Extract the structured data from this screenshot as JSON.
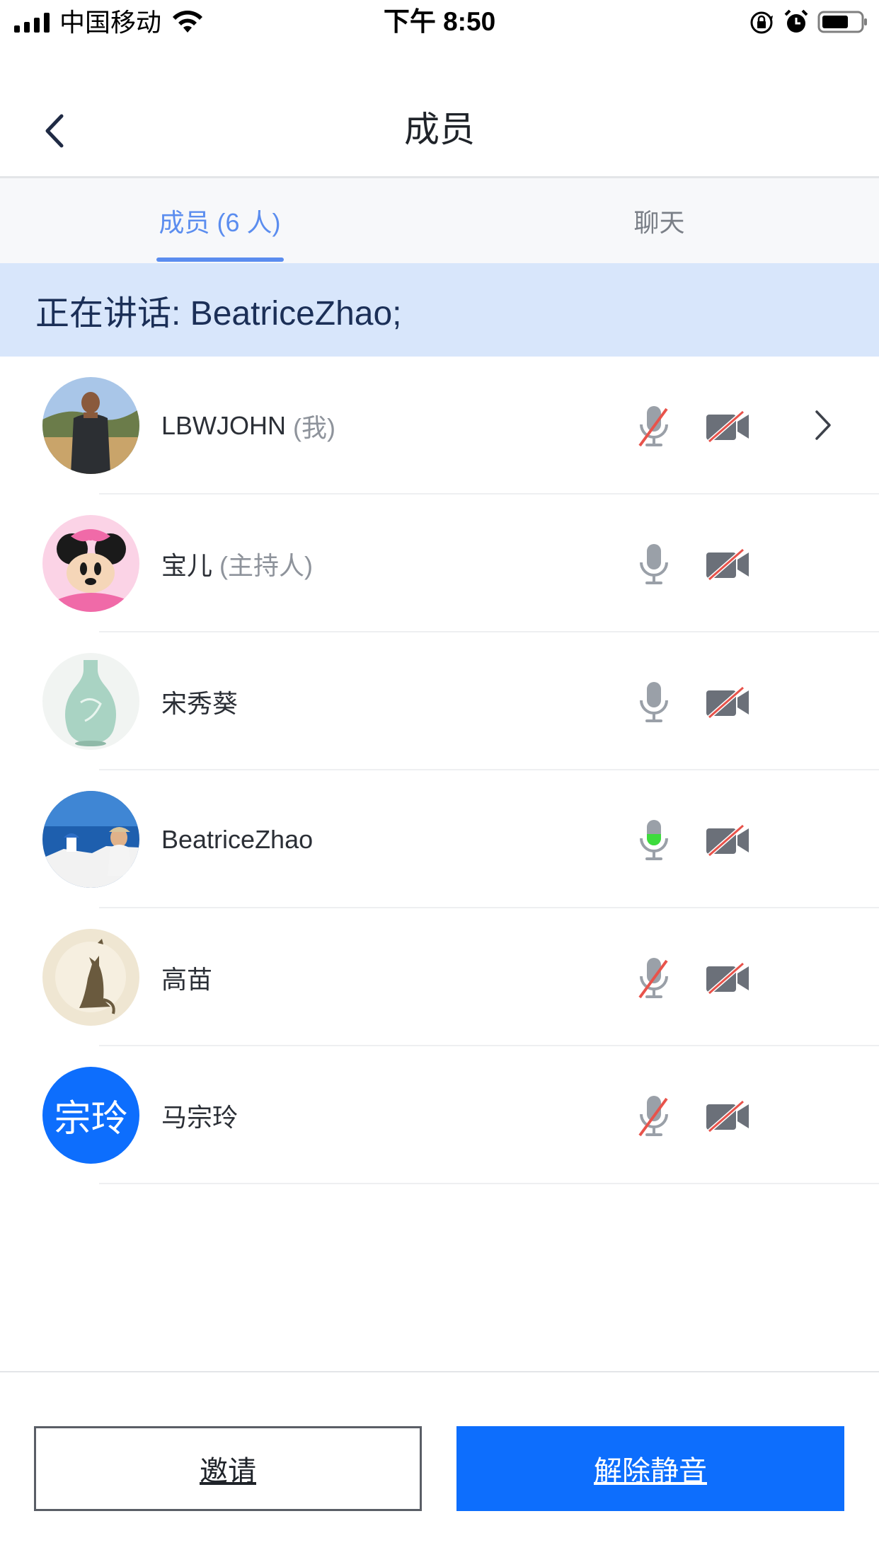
{
  "status_bar": {
    "carrier": "中国移动",
    "time": "下午 8:50"
  },
  "header": {
    "title": "成员"
  },
  "tabs": [
    {
      "label": "成员 (6 人)",
      "active": true
    },
    {
      "label": "聊天",
      "active": false
    }
  ],
  "speaking_banner": "正在讲话: BeatriceZhao;",
  "members": [
    {
      "name": "LBWJOHN",
      "role": "(我)",
      "avatar": "photo-man",
      "mic": "muted",
      "camera": "off",
      "has_chevron": true
    },
    {
      "name": "宝儿",
      "role": "(主持人)",
      "avatar": "minnie-mouse",
      "mic": "on",
      "camera": "off",
      "has_chevron": false
    },
    {
      "name": "宋秀葵",
      "role": "",
      "avatar": "celadon-vase",
      "mic": "on",
      "camera": "off",
      "has_chevron": false
    },
    {
      "name": "BeatriceZhao",
      "role": "",
      "avatar": "santorini-photo",
      "mic": "speaking",
      "camera": "off",
      "has_chevron": false
    },
    {
      "name": "高苗",
      "role": "",
      "avatar": "cat-illustration",
      "mic": "muted",
      "camera": "off",
      "has_chevron": false
    },
    {
      "name": "马宗玲",
      "role": "",
      "avatar": "initials",
      "initials": "宗玲",
      "mic": "muted",
      "camera": "off",
      "has_chevron": false
    }
  ],
  "footer": {
    "invite_label": "邀请",
    "unmute_label": "解除静音"
  },
  "colors": {
    "accent": "#5b8def",
    "primary_button": "#0d6efd",
    "banner": "#d8e6fb",
    "speaking_green": "#3ddc3d",
    "muted_red": "#e8534b"
  }
}
